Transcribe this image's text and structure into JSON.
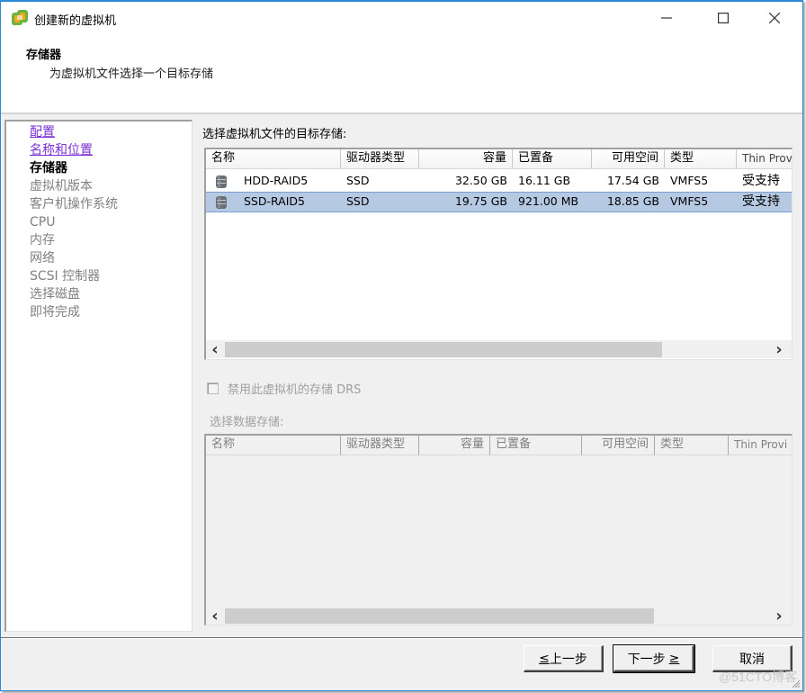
{
  "window": {
    "title": "创建新的虚拟机",
    "app_icon": "vsphere-icon",
    "controls": {
      "minimize": "minimize-icon",
      "maximize": "maximize-icon",
      "close": "close-icon"
    }
  },
  "header": {
    "title": "存储器",
    "subtitle": "为虚拟机文件选择一个目标存储"
  },
  "nav": {
    "items": [
      {
        "label": "配置",
        "state": "visited"
      },
      {
        "label": "名称和位置",
        "state": "visited"
      },
      {
        "label": "存储器",
        "state": "current"
      },
      {
        "label": "虚拟机版本",
        "state": "pending"
      },
      {
        "label": "客户机操作系统",
        "state": "pending"
      },
      {
        "label": "CPU",
        "state": "pending"
      },
      {
        "label": "内存",
        "state": "pending"
      },
      {
        "label": "网络",
        "state": "pending"
      },
      {
        "label": "SCSI 控制器",
        "state": "pending"
      },
      {
        "label": "选择磁盘",
        "state": "pending"
      },
      {
        "label": "即将完成",
        "state": "pending"
      }
    ]
  },
  "target_storage": {
    "label": "选择虚拟机文件的目标存储:",
    "columns": [
      "名称",
      "驱动器类型",
      "容量",
      "已置备",
      "可用空间",
      "类型",
      "Thin Prov"
    ],
    "rows": [
      {
        "icon": "datastore-icon",
        "name": "HDD-RAID5",
        "drive_type": "SSD",
        "capacity": "32.50 GB",
        "provisioned": "16.11 GB",
        "free": "17.54 GB",
        "type": "VMFS5",
        "thin": "受支持",
        "selected": false
      },
      {
        "icon": "datastore-icon",
        "name": "SSD-RAID5",
        "drive_type": "SSD",
        "capacity": "19.75 GB",
        "provisioned": "921.00 MB",
        "free": "18.85 GB",
        "type": "VMFS5",
        "thin": "受支持",
        "selected": true
      }
    ],
    "scroll": {
      "left": "‹",
      "right": "›"
    }
  },
  "drs_checkbox": {
    "label": "禁用此虚拟机的存储 DRS",
    "checked": false,
    "disabled": true
  },
  "datastore_select": {
    "label": "选择数据存储:",
    "columns": [
      "名称",
      "驱动器类型",
      "容量",
      "已置备",
      "可用空间",
      "类型",
      "Thin Provi"
    ],
    "rows": [],
    "scroll": {
      "left": "‹",
      "right": "›"
    }
  },
  "footer": {
    "back": {
      "prefix": "≤",
      "label": "上一步"
    },
    "next": {
      "label": "下一步",
      "suffix": "≥"
    },
    "cancel": {
      "label": "取消"
    }
  },
  "watermark": "@51CTO博客",
  "colors": {
    "accent_border": "#2b88d8",
    "selected_row": "#b5c9e2",
    "visited_link": "#7b2fd6",
    "disabled_text": "#808080"
  }
}
